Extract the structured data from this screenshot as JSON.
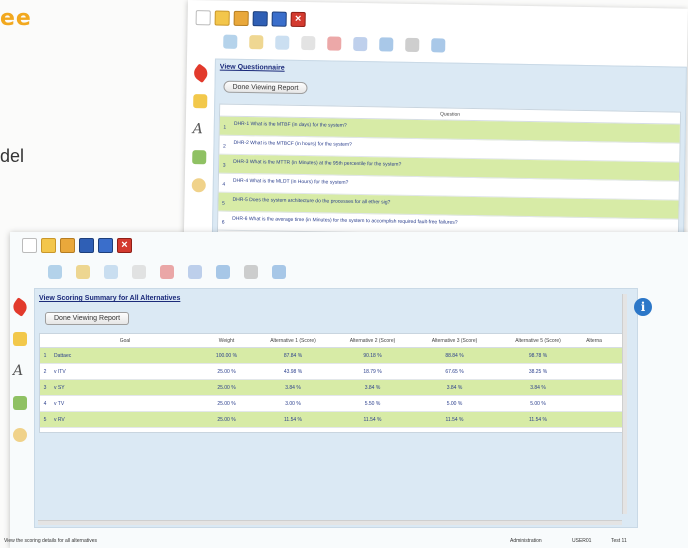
{
  "bg_text": {
    "top": "ee",
    "mid": "del"
  },
  "colors": {
    "accent": "#f2a81e",
    "panel": "#dbe9f4",
    "row_alt": "#d7eba6",
    "link": "#1b2a7a"
  },
  "back_window": {
    "toolbar_icons": [
      "new-doc-icon",
      "open-folder-icon",
      "open-folder-icon",
      "save-icon",
      "save-as-icon",
      "close-icon"
    ],
    "link": "View Questionnaire",
    "button": "Done Viewing Report",
    "table_header": "Question",
    "questions": [
      {
        "num": "1",
        "text": "DHR-1 What is the MTBF (in days) for the system?"
      },
      {
        "num": "2",
        "text": "DHR-2 What is the MTBCF (in hours) for the system?"
      },
      {
        "num": "3",
        "text": "DHR-3 What is the MTTR (in Minutes) at the 95th percentile for the system?"
      },
      {
        "num": "4",
        "text": "DHR-4 What is the MLDT (in Hours) for the system?"
      },
      {
        "num": "5",
        "text": "DHR-5 Does the system architecture do the processes for all ether sig?"
      },
      {
        "num": "6",
        "text": "DHR-6 What is the average time (in Minutes) for the system to accomplish required fault-free failures?"
      }
    ]
  },
  "front_window": {
    "link": "View Scoring Summary for All Alternatives",
    "button": "Done Viewing Report",
    "headers": [
      "",
      "Goal",
      "Weight",
      "Alternative 1 (Score)",
      "Alternative 2 (Score)",
      "Alternative 3 (Score)",
      "Alternative 5 (Score)",
      "Alterna"
    ],
    "rows": [
      {
        "n": "1",
        "goal": "Dattaec",
        "w": "100.00 %",
        "a1": "87.84 %",
        "a2": "90.18 %",
        "a3": "88.84 %",
        "a5": "98.78 %"
      },
      {
        "n": "2",
        "goal": "v ITV",
        "w": "25.00 %",
        "a1": "43.98 %",
        "a2": "18.79 %",
        "a3": "67.65 %",
        "a5": "38.25 %"
      },
      {
        "n": "3",
        "goal": "v SY",
        "w": "25.00 %",
        "a1": "3.84 %",
        "a2": "3.84 %",
        "a3": "3.84 %",
        "a5": "3.84 %"
      },
      {
        "n": "4",
        "goal": "v TV",
        "w": "25.00 %",
        "a1": "3.00 %",
        "a2": "5.50 %",
        "a3": "5.00 %",
        "a5": "5.00 %"
      },
      {
        "n": "5",
        "goal": "v RV",
        "w": "25.00 %",
        "a1": "11.54 %",
        "a2": "11.54 %",
        "a3": "11.54 %",
        "a5": "11.54 %"
      }
    ]
  },
  "status_bar": {
    "left": "View the scoring details for all alternatives",
    "role": "Administration",
    "user": "USER01",
    "test": "Test 11"
  }
}
